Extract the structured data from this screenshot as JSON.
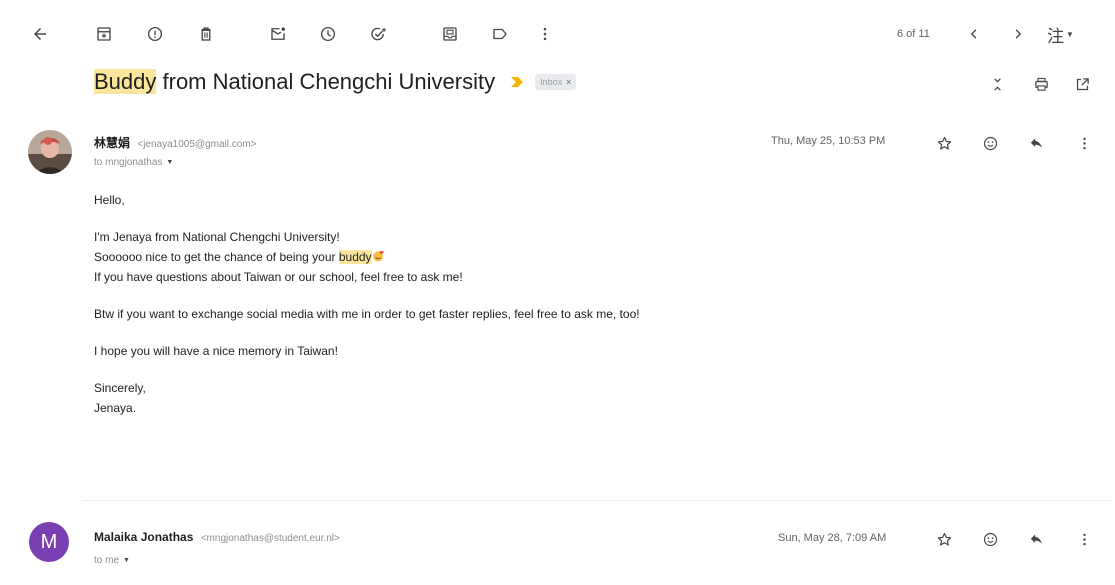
{
  "toolbar": {
    "icons": [
      "back-arrow-icon",
      "archive-icon",
      "report-spam-icon",
      "delete-icon",
      "mark-unread-icon",
      "snooze-icon",
      "add-to-tasks-icon",
      "move-to-icon",
      "labels-icon",
      "more-vert-icon"
    ],
    "page_count": "6 of 11",
    "input_tools_label": "注"
  },
  "thread": {
    "subject_highlight": "Buddy",
    "subject_rest": " from National Chengchi University",
    "label_chip": "Inbox",
    "label_remove": "×"
  },
  "messages": [
    {
      "sender_name": "林慧娟",
      "sender_email": "<jenaya1005@gmail.com>",
      "to": "to mngjonathas",
      "date": "Thu, May 25, 10:53 PM",
      "body": {
        "greeting": "Hello,",
        "line1": "I'm Jenaya from National  Chengchi University!",
        "line2_prefix": "Soooooo nice to get the chance of being your ",
        "line2_highlight": "buddy",
        "line3": "If you have questions about Taiwan or our school, feel free to ask me!",
        "line4": "Btw if you want to exchange social media with me in order to get faster replies, feel free to ask me, too!",
        "line5": "I hope you will have a nice memory in Taiwan!",
        "closing": "Sincerely,",
        "signature": "Jenaya."
      }
    },
    {
      "avatar_letter": "M",
      "avatar_color": "#7b3fb4",
      "sender_name": "Malaika Jonathas",
      "sender_email": "<mngjonathas@student.eur.nl>",
      "to": "to me",
      "date": "Sun, May 28, 7:09 AM"
    }
  ],
  "colors": {
    "highlight": "#fbe59a",
    "importance_marker": "#f4b400",
    "icon_gray": "#444746"
  }
}
